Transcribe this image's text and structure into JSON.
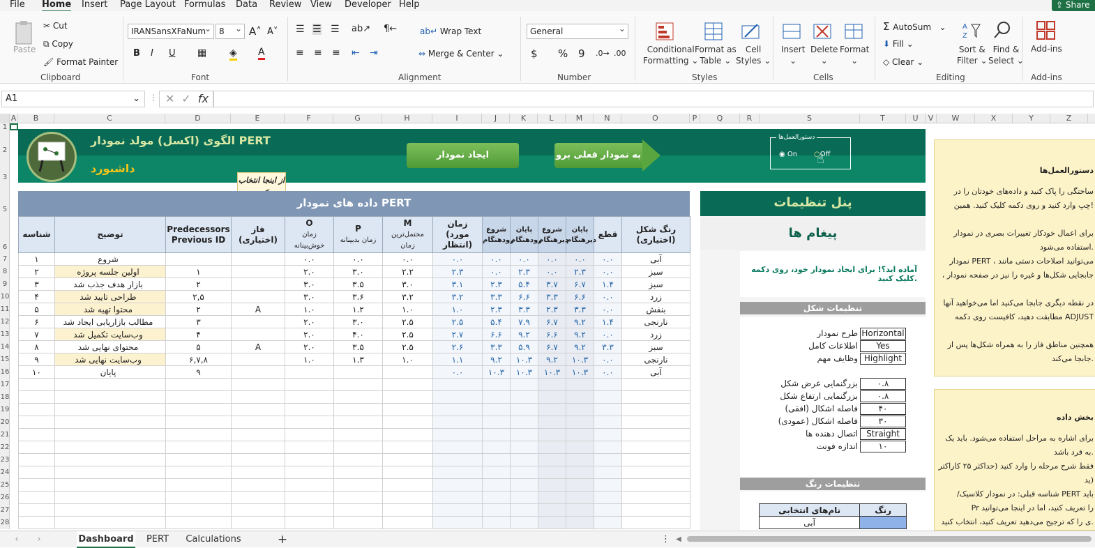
{
  "menu": [
    "File",
    "Home",
    "Insert",
    "Page Layout",
    "Formulas",
    "Data",
    "Review",
    "View",
    "Developer",
    "Help"
  ],
  "share_label": "Share",
  "ribbon": {
    "clipboard": {
      "paste": "Paste",
      "cut": "Cut",
      "copy": "Copy",
      "format_painter": "Format Painter",
      "group": "Clipboard"
    },
    "font": {
      "name": "IRANSansXFaNum",
      "size": "8",
      "bold": "B",
      "italic": "I",
      "underline": "U",
      "group": "Font"
    },
    "alignment": {
      "wrap": "Wrap Text",
      "merge": "Merge & Center",
      "group": "Alignment"
    },
    "number": {
      "format": "General",
      "currency": "$",
      "percent": "%",
      "comma": "9",
      "group": "Number"
    },
    "styles": {
      "conditional": "Conditional",
      "conditional2": "Formatting",
      "format_table": "Format as",
      "format_table2": "Table",
      "cell_styles": "Cell",
      "cell_styles2": "Styles",
      "group": "Styles"
    },
    "cells": {
      "insert": "Insert",
      "delete": "Delete",
      "format": "Format",
      "group": "Cells"
    },
    "editing": {
      "autosum": "AutoSum",
      "fill": "Fill",
      "clear": "Clear",
      "sort": "Sort &",
      "sort2": "Filter",
      "find": "Find &",
      "find2": "Select",
      "group": "Editing"
    },
    "addins": {
      "label": "Add-ins",
      "group": "Add-ins"
    }
  },
  "formula_bar": {
    "name_box": "A1",
    "fx": "fx",
    "content": ""
  },
  "columns": [
    "A",
    "B",
    "C",
    "D",
    "E",
    "F",
    "G",
    "H",
    "I",
    "J",
    "K",
    "L",
    "M",
    "N",
    "O",
    "P",
    "Q",
    "R",
    "S",
    "T",
    "U",
    "V",
    "W",
    "X",
    "Y",
    "Z"
  ],
  "rows": [
    "1",
    "2",
    "3",
    "5",
    "6",
    "7",
    "8",
    "9",
    "10",
    "11",
    "12",
    "13",
    "14",
    "15",
    "16",
    "17",
    "18",
    "19",
    "20",
    "21",
    "22",
    "23",
    "24",
    "25",
    "26",
    "27",
    "28"
  ],
  "dashboard": {
    "title": "الگوی (اکسل) مولد نمودار PERT",
    "subtitle": "داشبورد",
    "btn_create": "ایجاد نمودار",
    "btn_goto": "به نمودار فعلی برو",
    "callout": "از اینجا انتخاب کنید",
    "instructions_toggle": {
      "title": "دستورالعمل‌ها",
      "on": "On",
      "off": "Off"
    },
    "table_title": "داده های نمودار PERT",
    "headers": {
      "id": "شناسه",
      "desc": "توضیح",
      "pred1": "Predecessors",
      "pred2": "Previous ID",
      "phase": "فاز (اختیاری)",
      "o1": "O",
      "o2": "زمان",
      "o3": "خوش‌بینانه",
      "p1": "P",
      "p2": "زمان بدبینانه",
      "m1": "M",
      "m2": "محتمل‌ترین",
      "m3": "زمان",
      "t1": "زمان",
      "t2": "(مورد انتظار)",
      "es": "شروع زودهنگام",
      "ef": "پایان زودهنگام",
      "ls": "شروع دیرهنگام",
      "lf": "پایان دیرهنگام",
      "crit": "قطع",
      "color1": "رنگ شکل",
      "color2": "(اختیاری)"
    },
    "rows": [
      {
        "id": "۱",
        "desc": "شروع",
        "pred": "",
        "phase": "",
        "o": "۰.۰",
        "p": "۰.۰",
        "m": "۰.۰",
        "t": "۰.۰",
        "es": "۰.۰",
        "ef": "۰.۰",
        "ls": "۰.۰",
        "lf": "۰.۰",
        "crit": "۰.۰",
        "color": "آبی",
        "hl": false
      },
      {
        "id": "۲",
        "desc": "اولین جلسه پروژه",
        "pred": "۱",
        "phase": "",
        "o": "۲.۰",
        "p": "۳.۰",
        "m": "۲.۲",
        "t": "۲.۳",
        "es": "۰.۰",
        "ef": "۲.۳",
        "ls": "۰.۰",
        "lf": "۲.۳",
        "crit": "۰.۰",
        "color": "سبز",
        "hl": true
      },
      {
        "id": "۳",
        "desc": "بازار هدف جذب شد",
        "pred": "۲",
        "phase": "",
        "o": "۳.۰",
        "p": "۳.۵",
        "m": "۳.۰",
        "t": "۳.۱",
        "es": "۲.۳",
        "ef": "۵.۴",
        "ls": "۳.۷",
        "lf": "۶.۷",
        "crit": "۱.۴",
        "color": "سبز",
        "hl": false
      },
      {
        "id": "۴",
        "desc": "طراحی تایید شد",
        "pred": "۲,۵",
        "phase": "",
        "o": "۳.۰",
        "p": "۳.۶",
        "m": "۳.۲",
        "t": "۳.۲",
        "es": "۳.۳",
        "ef": "۶.۶",
        "ls": "۳.۳",
        "lf": "۶.۶",
        "crit": "۰.۰",
        "color": "زرد",
        "hl": true
      },
      {
        "id": "۵",
        "desc": "محتوا تهیه شد",
        "pred": "۲",
        "phase": "A",
        "o": "۱.۰",
        "p": "۱.۲",
        "m": "۱.۰",
        "t": "۱.۰",
        "es": "۲.۳",
        "ef": "۳.۳",
        "ls": "۲.۳",
        "lf": "۳.۳",
        "crit": "۰.۰",
        "color": "بنفش",
        "hl": true
      },
      {
        "id": "۶",
        "desc": "مطالب بازاریابی ایجاد شد",
        "pred": "۳",
        "phase": "",
        "o": "۲.۰",
        "p": "۳.۰",
        "m": "۲.۵",
        "t": "۲.۵",
        "es": "۵.۴",
        "ef": "۷.۹",
        "ls": "۶.۷",
        "lf": "۹.۲",
        "crit": "۱.۴",
        "color": "نارنجی",
        "hl": false
      },
      {
        "id": "۷",
        "desc": "وب‌سایت تکمیل شد",
        "pred": "۴",
        "phase": "",
        "o": "۲.۰",
        "p": "۴.۰",
        "m": "۲.۵",
        "t": "۲.۷",
        "es": "۶.۶",
        "ef": "۹.۲",
        "ls": "۶.۶",
        "lf": "۹.۲",
        "crit": "۰.۰",
        "color": "زرد",
        "hl": true
      },
      {
        "id": "۸",
        "desc": "محتوای نهایی شد",
        "pred": "۵",
        "phase": "A",
        "o": "۲.۰",
        "p": "۳.۵",
        "m": "۲.۵",
        "t": "۲.۶",
        "es": "۳.۳",
        "ef": "۵.۹",
        "ls": "۶.۷",
        "lf": "۹.۲",
        "crit": "۳.۳",
        "color": "سبز",
        "hl": false
      },
      {
        "id": "۹",
        "desc": "وب‌سایت نهایی شد",
        "pred": "۶,۷,۸",
        "phase": "",
        "o": "۱.۰",
        "p": "۱.۳",
        "m": "۱.۰",
        "t": "۱.۱",
        "es": "۹.۲",
        "ef": "۱۰.۳",
        "ls": "۹.۲",
        "lf": "۱۰.۳",
        "crit": "۰.۰",
        "color": "نارنجی",
        "hl": true
      },
      {
        "id": "۱۰",
        "desc": "پایان",
        "pred": "۹",
        "phase": "",
        "o": "",
        "p": "",
        "m": "",
        "t": "۰.۰",
        "es": "۱۰.۳",
        "ef": "۱۰.۳",
        "ls": "۱۰.۳",
        "lf": "۱۰.۳",
        "crit": "۰.۰",
        "color": "آبی",
        "hl": false
      }
    ]
  },
  "panel": {
    "title": "پنل تنظیمات",
    "messages_title": "پیغام ها",
    "message": "آماده اید؟! برای ایجاد نمودار خود، روی دکمه کلیک کنید.",
    "shape_settings": "تنظیمات شکل",
    "settings": [
      {
        "label": "طرح نمودار",
        "value": "Horizontal"
      },
      {
        "label": "اطلاعات کامل",
        "value": "Yes"
      },
      {
        "label": "وظایف مهم",
        "value": "Highlight"
      }
    ],
    "settings2": [
      {
        "label": "بزرگنمایی عرض شکل",
        "value": "۰.۸"
      },
      {
        "label": "بزرگنمایی ارتفاع شکل",
        "value": "۰.۸"
      },
      {
        "label": "فاصله اشکال (افقی)",
        "value": "۴۰"
      },
      {
        "label": "فاصله اشکال (عمودی)",
        "value": "۳۰"
      },
      {
        "label": "اتصال دهنده ها",
        "value": "Straight"
      },
      {
        "label": "اندازه فونت",
        "value": "۱۰"
      }
    ],
    "color_settings": "تنظیمات رنگ",
    "color_table": {
      "h_names": "نام‌های انتخابی",
      "h_color": "رنگ",
      "first": "آبی"
    }
  },
  "notes": {
    "n1_title": "دستورالعمل‌ها",
    "n1_lines": [
      "ساختگی را پاک کنید و داده‌های خودتان را در",
      "چپ وارد کنید و روی دکمه کلیک کنید. همین!",
      "",
      "برای اعمال خودکار تغییرات بصری در نمودار",
      "استفاده می‌شود.",
      "نمودار PERT ، می‌توانید اصلاحات دستی مانند",
      "، جابجایی شکل‌ها و غیره را نیز در صفحه نمودار",
      "",
      "در نقطه دیگری جابجا می‌کنید اما می‌خواهید آنها",
      "مطابقت دهید، کافیست روی دکمه ADJUST",
      "",
      "همچنین مناطق فاز را به همراه شکل‌ها پس از",
      "جابجا می‌کند."
    ],
    "n2_title": "بخش داده",
    "n2_lines": [
      "برای اشاره به مراحل استفاده می‌شود. باید یک",
      "به فرد باشد.",
      "فقط شرح مرحله را وارد کنید (حداکثر ۲۵ کاراکتر",
      "ید)",
      "/شناسه قبلی: در نمودار کلاسیک PERT باید",
      "Pr را تعریف کنید، اما در اینجا می‌توانید",
      "ی را که ترجیح می‌دهید تعریف کنید، انتخاب کنید."
    ]
  },
  "sheets": [
    "Dashboard",
    "PERT",
    "Calculations"
  ],
  "colors": {
    "brand": "#1e7145",
    "banner": "#096b56",
    "table_header": "#7f96b5"
  }
}
